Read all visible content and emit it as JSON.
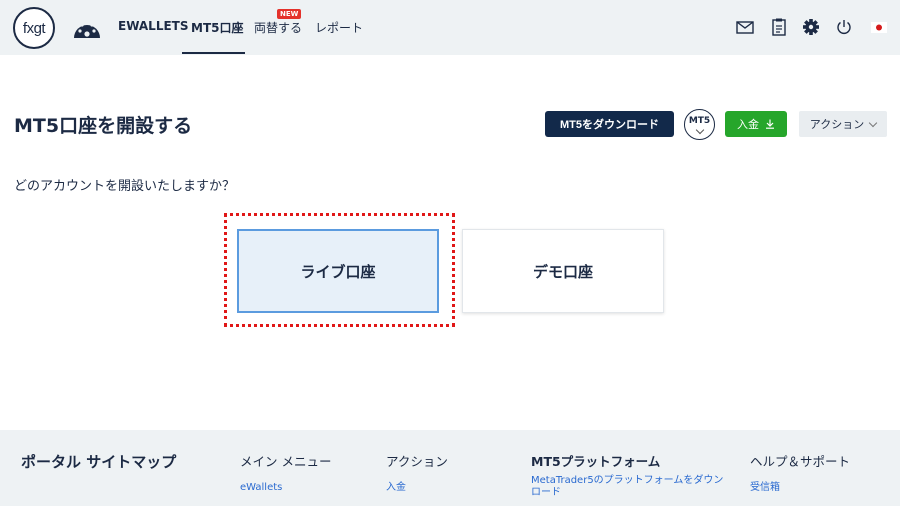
{
  "header": {
    "logo_text": "fxgt",
    "nav": [
      {
        "label": "EWALLETS"
      },
      {
        "label": "MT5口座",
        "active": true
      },
      {
        "label": "両替する",
        "badge": "NEW"
      },
      {
        "label": "レポート"
      }
    ],
    "icons": [
      "dashboard-gauge-icon",
      "mail-icon",
      "clipboard-icon",
      "gear-icon",
      "power-icon",
      "japan-flag-icon"
    ]
  },
  "page": {
    "title": "MT5口座を開設する",
    "download_button": "MT5をダウンロード",
    "mt5_badge": "MT5",
    "deposit_button": "入金",
    "action_dropdown": "アクション",
    "question": "どのアカウントを開設いたしますか？"
  },
  "choices": {
    "live": "ライブ口座",
    "demo": "デモ口座"
  },
  "footer": {
    "title": "ポータル サイトマップ",
    "columns": [
      {
        "heading": "メイン メニュー",
        "link": "eWallets"
      },
      {
        "heading": "アクション",
        "link": "入金"
      },
      {
        "heading": "MT5プラットフォーム",
        "link": "MetaTrader5のプラットフォームをダウンロード"
      },
      {
        "heading": "ヘルプ＆サポート",
        "link": "受信箱"
      }
    ]
  },
  "colors": {
    "brand_navy": "#12294a",
    "deposit_green": "#26a62b",
    "selected_card_fill": "#e7f0f9",
    "selected_card_border": "#5b9bdf",
    "highlight_red": "#e01717",
    "new_badge_red": "#e4322b"
  }
}
